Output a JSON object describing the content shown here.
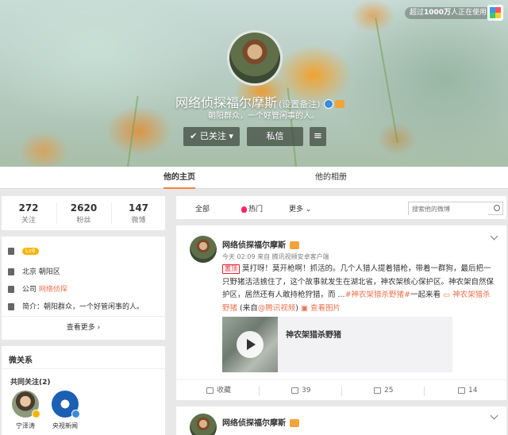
{
  "banner": {
    "online_count_prefix": "超过",
    "online_count_value": "1000万",
    "online_count_suffix": "人正在使用",
    "profile_name": "网络侦探福尔摩斯",
    "profile_remark": "(设置备注)",
    "profile_intro": "朝阳群众，一个好管闲事的人。",
    "follow_button": "已关注",
    "message_button": "私信",
    "more_button": "≡"
  },
  "tabs": [
    {
      "label": "他的主页",
      "active": true
    },
    {
      "label": "他的相册",
      "active": false
    }
  ],
  "stats": [
    {
      "value": "272",
      "label": "关注"
    },
    {
      "value": "2620",
      "label": "粉丝"
    },
    {
      "value": "147",
      "label": "微博"
    }
  ],
  "info": {
    "level": "Lv8",
    "location": "北京 朝阳区",
    "company_prefix": "公司",
    "company": "网络侦探",
    "intro_prefix": "简介：",
    "intro": "朝阳群众，一个好管闲事的人。",
    "see_more": "查看更多 ›"
  },
  "relations": {
    "title": "微关系",
    "mutual_label": "共同关注(2)",
    "friends": [
      {
        "name": "宁泽涛"
      },
      {
        "name": "央视新闻"
      }
    ]
  },
  "filter": {
    "all": "全部",
    "hot": "热门",
    "more": "更多",
    "search_placeholder": "搜索他的微博"
  },
  "post": {
    "author": "网络侦探福尔摩斯",
    "meta": "今天 02:09 来自 腾讯视频安卓客户端",
    "top_tag": "置顶",
    "text_main": "莫打呀！莫开枪啊！抓活的。几个人猎人提着猎枪，带着一群狗，最后把一只野猪活活掳住了，这个故事就发生在湖北省，神农架核心保护区。神农架自然保护区，居然还有人敢持枪狩猎，而 ...",
    "hashtag1": "#神农架猎杀野猪#",
    "text_mid": "一起来看",
    "link_label": "神农架猎杀野猪",
    "text_source_pre": " (来自",
    "source": "@腾讯视频",
    "text_source_post": ")",
    "view_pic": "查看图片",
    "video_title": "神农架猎杀野猪",
    "actions": {
      "collect": "收藏",
      "repost": "39",
      "comment": "25",
      "like": "14"
    }
  },
  "post2": {
    "author": "网络侦探福尔摩斯"
  }
}
